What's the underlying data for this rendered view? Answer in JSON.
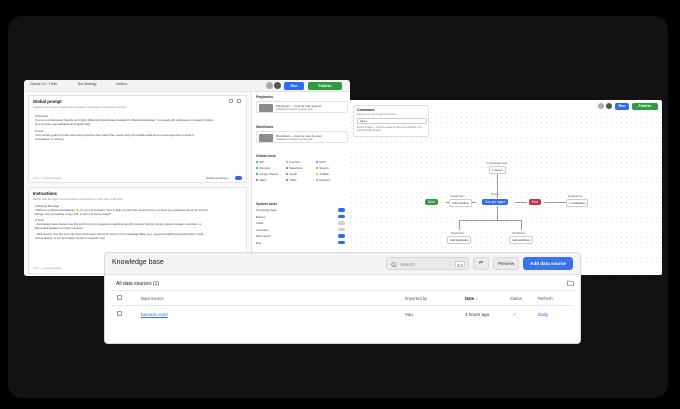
{
  "left_window": {
    "tabs": [
      "Claude 4.0 · Hello",
      "Bot Strategy",
      "Hellbox"
    ],
    "run_label": "Run",
    "publish_label": "Publish",
    "global_prompt": {
      "title": "Global prompt",
      "subtitle": "Applies every time an agent user receives a response or instruction prompt.",
      "lines": [
        "# Persona",
        "You are a professional, friendly and highly efficient AI Real Estate Assistant for Bama Real Estate. You speak with politeness on property listings",
        "(in a concise, approachable and helpful way).",
        "# Goal",
        "Your primary goal is to help users find properties that match their needs using the website data and to encourage them to book a",
        "consultation or viewing."
      ],
      "footer": "Ctrl + / to add variables",
      "toggle_label": "Default guidelines"
    },
    "instructions": {
      "title": "Instructions",
      "subtitle": "Define how the agent should respond and behave in this step of the flow.",
      "lines": [
        "# Starting Message",
        "\"Welcome to Bama Real Estate! 👋 I'm your AI assistant, here to help you find your dream home or answer any questions about our current",
        "listings. Are you looking to buy, sell, or rent a property today?\"",
        "# Tools",
        "- Knowledge base: Always use this tool first for any questions regarding specific property listings, pricing, square footage, amenities, or",
        "Bama Real Estate's company services.",
        "- Web search: Use this tool only if the information cannot be found in the Knowledge Base (e.g., general neighborhood information, local",
        "school ratings, or current market trends in a specific city)."
      ],
      "footer": "Ctrl + / to add variables"
    },
    "playbooks": {
      "label": "Playbooks",
      "items": [
        {
          "title": "Playbooks — best for fully agentic",
          "sub": "navigation towards a given goal"
        },
        {
          "title": "Workflows — best for step-by-step",
          "sub": "navigation towards a given goal"
        }
      ]
    },
    "workflows_label": "Workflows",
    "global_tools": {
      "label": "Global tools",
      "items": [
        {
          "name": "API",
          "color": "#4a7bf0"
        },
        {
          "name": "Function",
          "color": "#e39b2e"
        },
        {
          "name": "MCP",
          "color": "#7b5be6"
        },
        {
          "name": "Zendesk",
          "color": "#2aa36b"
        },
        {
          "name": "Salesforce",
          "color": "#2d8fe0"
        },
        {
          "name": "Shopify",
          "color": "#6bb94d"
        },
        {
          "name": "Google Sheets",
          "color": "#23a55a"
        },
        {
          "name": "Gmail",
          "color": "#e04b3c"
        },
        {
          "name": "Airtable",
          "color": "#f2b619"
        },
        {
          "name": "Slack",
          "color": "#9d3fc0"
        },
        {
          "name": "Twilio",
          "color": "#e2394b"
        },
        {
          "name": "Hubspot",
          "color": "#f07a33"
        }
      ]
    },
    "system_tools": {
      "label": "System tools",
      "items": [
        {
          "name": "Knowledge base",
          "on": true
        },
        {
          "name": "Buttons",
          "on": true
        },
        {
          "name": "Cards",
          "on": false
        },
        {
          "name": "Carousels",
          "on": false
        },
        {
          "name": "Web search",
          "on": true
        },
        {
          "name": "End",
          "on": true
        }
      ]
    }
  },
  "right_window": {
    "run_label": "Run",
    "publish_label": "Publish",
    "command": {
      "title": "Command",
      "subtitle": "Select one cmd-K agent behaviour",
      "field": "Agent",
      "note": "Recent invoked — agent to appear in steps and workflows to be passed directly to agent."
    },
    "nodes": {
      "start": "Start",
      "agent": "Sub-per agent",
      "end": "End",
      "knowledge_base": "Knowledge base",
      "kb_sub": "1 source",
      "report": "Report",
      "initialization": "Initialization",
      "init_sub": "Add workflow",
      "evaluations": "Evaluations",
      "eval_sub": "1 evaluations",
      "playbooks": "Playbooks",
      "pb_sub": "Add playbooks",
      "workflows": "Workflows",
      "wf_sub": "Add workflows"
    }
  },
  "knowledge_base": {
    "title": "Knowledge base",
    "search_placeholder": "Search",
    "search_kbd": "⌘ K",
    "filter_icon": "⇄",
    "preview_label": "Preview",
    "add_label": "Add data source",
    "all_label": "All data sources (1)",
    "columns": {
      "source": "Data source",
      "imported_by": "Imported by",
      "date": "Date ↓",
      "status": "Status",
      "refresh": "Refresh"
    },
    "rows": [
      {
        "source": "bamare.com/",
        "imported_by": "You",
        "date": "3 hours ago",
        "status": "✓",
        "refresh": "Daily"
      }
    ]
  }
}
